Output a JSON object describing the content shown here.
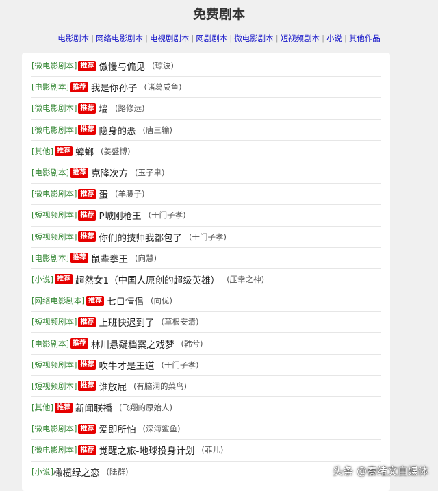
{
  "page": {
    "title": "免费剧本"
  },
  "nav": {
    "items": [
      "电影剧本",
      "网络电影剧本",
      "电视剧剧本",
      "网剧剧本",
      "微电影剧本",
      "短视频剧本",
      "小说",
      "其他作品"
    ]
  },
  "colors": {
    "nav_link": "#1515c8",
    "category": "#3a8a3a",
    "badge_bg": "#e60000",
    "background": "#f0f0f0",
    "card": "#ffffff"
  },
  "list": {
    "items": [
      {
        "category": "[微电影剧本]",
        "badge": "推荐",
        "title": "傲慢与偏见",
        "author": "(琼波)"
      },
      {
        "category": "[电影剧本]",
        "badge": "推荐",
        "title": "我是你孙子",
        "author": "(诸葛咸鱼)"
      },
      {
        "category": "[微电影剧本]",
        "badge": "推荐",
        "title": "墙",
        "author": "(路修远)"
      },
      {
        "category": "[微电影剧本]",
        "badge": "推荐",
        "title": "隐身的恶",
        "author": "(唐三输)"
      },
      {
        "category": "[其他]",
        "badge": "推荐",
        "title": "蟑螂",
        "author": "(姜盛博)"
      },
      {
        "category": "[电影剧本]",
        "badge": "推荐",
        "title": "克隆次方",
        "author": "(玉子聿)"
      },
      {
        "category": "[微电影剧本]",
        "badge": "推荐",
        "title": "蛋",
        "author": "(羊腰子)"
      },
      {
        "category": "[短视频剧本]",
        "badge": "推荐",
        "title": "P城刚枪王",
        "author": "(于门子孝)"
      },
      {
        "category": "[短视频剧本]",
        "badge": "推荐",
        "title": "你们的技师我都包了",
        "author": "(于门子孝)"
      },
      {
        "category": "[电影剧本]",
        "badge": "推荐",
        "title": "鼠辈拳王",
        "author": "(向慧)"
      },
      {
        "category": "[小说]",
        "badge": "推荐",
        "title": "超然女1（中国人原创的超级英雄）",
        "author": "(压幸之神)"
      },
      {
        "category": "[网络电影剧本]",
        "badge": "推荐",
        "title": "七日情侣",
        "author": "(向优)"
      },
      {
        "category": "[短视频剧本]",
        "badge": "推荐",
        "title": "上班快迟到了",
        "author": "(草根安清)"
      },
      {
        "category": "[电影剧本]",
        "badge": "推荐",
        "title": "林川悬疑档案之戏梦",
        "author": "(韩兮)"
      },
      {
        "category": "[短视频剧本]",
        "badge": "推荐",
        "title": "吹牛才是王道",
        "author": "(于门子孝)"
      },
      {
        "category": "[短视频剧本]",
        "badge": "推荐",
        "title": "谁放屁",
        "author": "(有脑洞的菜鸟)"
      },
      {
        "category": "[其他]",
        "badge": "推荐",
        "title": "新闻联播",
        "author": "(飞翔的原始人)"
      },
      {
        "category": "[微电影剧本]",
        "badge": "推荐",
        "title": "爱即所怕",
        "author": "(深海鲨鱼)"
      },
      {
        "category": "[微电影剧本]",
        "badge": "推荐",
        "title": "觉醒之旅-地球投身计划",
        "author": "(菲儿)"
      },
      {
        "category": "[小说]",
        "badge": "",
        "title": "橄榄绿之恋",
        "author": "(陆群)"
      }
    ]
  },
  "watermark": {
    "text": "头条 @秦绪文自媒体"
  }
}
